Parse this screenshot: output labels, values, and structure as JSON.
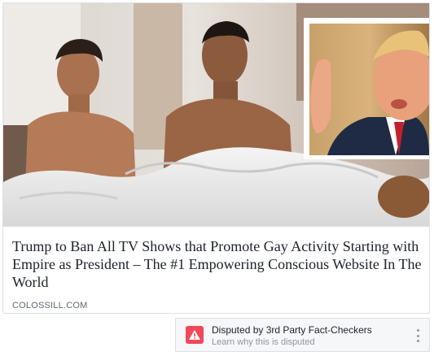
{
  "link_preview": {
    "headline": "Trump to Ban All TV Shows that Promote Gay Activity Starting with Empire as President – The #1 Empowering Conscious Website In The World",
    "domain": "COLOSSILL.COM",
    "image_icon": "photo"
  },
  "dispute_notice": {
    "title": "Disputed by 3rd Party Fact-Checkers",
    "subtitle": "Learn why this is disputed",
    "icon": "warning-icon",
    "menu_icon": "more-options-icon",
    "accent_color": "#f0475a"
  }
}
